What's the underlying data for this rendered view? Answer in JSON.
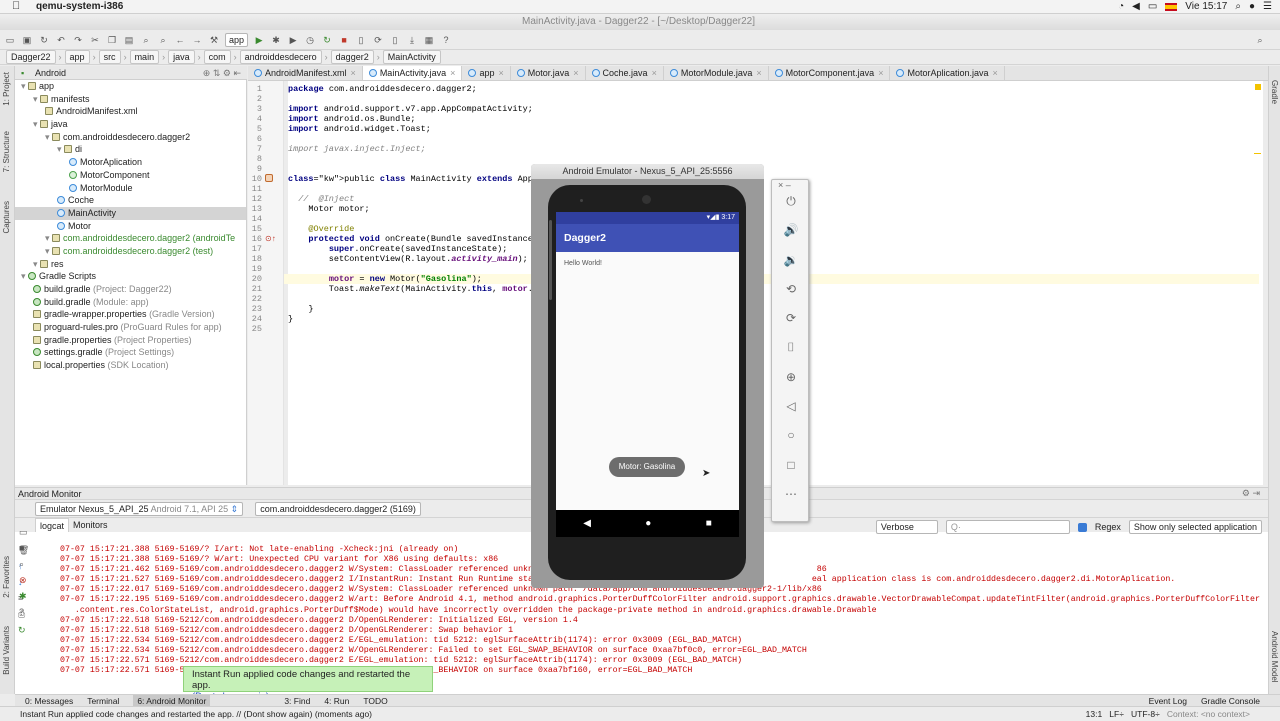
{
  "menubar": {
    "app_name": "qemu-system-i386",
    "clock": "Vie 15:17"
  },
  "window": {
    "title": "MainActivity.java - Dagger22 - [~/Desktop/Dagger22]"
  },
  "toolbar": {
    "config": "app"
  },
  "breadcrumbs": [
    "Dagger22",
    "app",
    "src",
    "main",
    "java",
    "com",
    "androiddesdecero",
    "dagger2",
    "MainActivity"
  ],
  "project_panel": {
    "view_mode": "Android",
    "rows": [
      {
        "label": "app",
        "note": "",
        "indent": 0,
        "icon": "folder"
      },
      {
        "label": "manifests",
        "note": "",
        "indent": 1,
        "icon": "folder"
      },
      {
        "label": "AndroidManifest.xml",
        "note": "",
        "indent": 2,
        "icon": "file"
      },
      {
        "label": "java",
        "note": "",
        "indent": 1,
        "icon": "folder"
      },
      {
        "label": "com.androiddesdecero.dagger2",
        "note": "",
        "indent": 2,
        "icon": "folder"
      },
      {
        "label": "di",
        "note": "",
        "indent": 3,
        "icon": "folder"
      },
      {
        "label": "MotorAplication",
        "note": "",
        "indent": 4,
        "icon": "class"
      },
      {
        "label": "MotorComponent",
        "note": "",
        "indent": 4,
        "icon": "interface"
      },
      {
        "label": "MotorModule",
        "note": "",
        "indent": 4,
        "icon": "class"
      },
      {
        "label": "Coche",
        "note": "",
        "indent": 3,
        "icon": "class"
      },
      {
        "label": "MainActivity",
        "note": "",
        "indent": 3,
        "icon": "class",
        "selected": true
      },
      {
        "label": "Motor",
        "note": "",
        "indent": 3,
        "icon": "class"
      },
      {
        "label": "com.androiddesdecero.dagger2",
        "note": "(androidTe",
        "indent": 2,
        "icon": "folder"
      },
      {
        "label": "com.androiddesdecero.dagger2",
        "note": "(test)",
        "indent": 2,
        "icon": "folder"
      },
      {
        "label": "res",
        "note": "",
        "indent": 1,
        "icon": "folder"
      },
      {
        "label": "Gradle Scripts",
        "note": "",
        "indent": 0,
        "icon": "gradle"
      },
      {
        "label": "build.gradle",
        "note": "(Project: Dagger22)",
        "indent": 1,
        "icon": "gradle"
      },
      {
        "label": "build.gradle",
        "note": "(Module: app)",
        "indent": 1,
        "icon": "gradle"
      },
      {
        "label": "gradle-wrapper.properties",
        "note": "(Gradle Version)",
        "indent": 1,
        "icon": "file"
      },
      {
        "label": "proguard-rules.pro",
        "note": "(ProGuard Rules for app)",
        "indent": 1,
        "icon": "file"
      },
      {
        "label": "gradle.properties",
        "note": "(Project Properties)",
        "indent": 1,
        "icon": "file"
      },
      {
        "label": "settings.gradle",
        "note": "(Project Settings)",
        "indent": 1,
        "icon": "gradle"
      },
      {
        "label": "local.properties",
        "note": "(SDK Location)",
        "indent": 1,
        "icon": "file"
      }
    ]
  },
  "editor_tabs": [
    {
      "label": "AndroidManifest.xml",
      "active": false
    },
    {
      "label": "MainActivity.java",
      "active": true
    },
    {
      "label": "app",
      "active": false
    },
    {
      "label": "Motor.java",
      "active": false
    },
    {
      "label": "Coche.java",
      "active": false
    },
    {
      "label": "MotorModule.java",
      "active": false
    },
    {
      "label": "MotorComponent.java",
      "active": false
    },
    {
      "label": "MotorAplication.java",
      "active": false
    }
  ],
  "code": {
    "line_numbers": [
      "1",
      "2",
      "3",
      "4",
      "5",
      "6",
      "7",
      "8",
      "9",
      "10",
      "11",
      "12",
      "13",
      "14",
      "15",
      "16",
      "17",
      "18",
      "19",
      "20",
      "21",
      "22",
      "23",
      "24",
      "25"
    ],
    "l1": "package com.androiddesdecero.dagger2;",
    "l3": "import android.support.v7.app.AppCompatActivity;",
    "l4": "import android.os.Bundle;",
    "l5": "import android.widget.Toast;",
    "l7": "import javax.inject.Inject;",
    "l10": "public class MainActivity extends AppCompatActivity",
    "l12": "  //  @Inject",
    "l13": "    Motor motor;",
    "l15": "    @Override",
    "l16": "    protected void onCreate(Bundle savedInstanceStat",
    "l17": "        super.onCreate(savedInstanceState);",
    "l18": "        setContentView(R.layout.activity_main);",
    "l20": "        motor = new Motor(\"Gasolina\");",
    "l21": "        Toast.makeText(MainActivity.this, motor.getT",
    "l23": "    }",
    "l24": "}"
  },
  "emulator": {
    "title": "Android Emulator - Nexus_5_API_25:5556",
    "status_time": "3:17",
    "app_title": "Dagger2",
    "body_text": "Hello World!",
    "toast_text": "Motor: Gasolina"
  },
  "monitor": {
    "title": "Android Monitor",
    "device": "Emulator Nexus_5_API_25",
    "device_note": "Android 7.1, API 25",
    "process": "com.androiddesdecero.dagger2",
    "process_pid": "(5169)",
    "tab_logcat": "logcat",
    "tab_monitors": "Monitors",
    "level": "Verbose",
    "search_placeholder": "Q·",
    "regex_label": "Regex",
    "filter": "Show only selected application",
    "log_lines": [
      "07-07 15:17:21.388 5169-5169/? I/art: Not late-enabling -Xcheck:jni (already on)",
      "07-07 15:17:21.388 5169-5169/? W/art: Unexpected CPU variant for X86 using defaults: x86",
      "07-07 15:17:21.462 5169-5169/com.androiddesdecero.dagger2 W/System: ClassLoader referenced unknown pa                                                   86",
      "07-07 15:17:21.527 5169-5169/com.androiddesdecero.dagger2 I/InstantRun: Instant Run Runtime started.                                                   eal application class is com.androiddesdecero.dagger2.di.MotorAplication.",
      "07-07 15:17:22.017 5169-5169/com.androiddesdecero.dagger2 W/System: ClassLoader referenced unknown path: /data/app/com.androiddesdecero.dagger2-1/lib/x86",
      "07-07 15:17:22.195 5169-5169/com.androiddesdecero.dagger2 W/art: Before Android 4.1, method android.graphics.PorterDuffColorFilter android.support.graphics.drawable.VectorDrawableCompat.updateTintFilter(android.graphics.PorterDuffColorFilter, android",
      "   .content.res.ColorStateList, android.graphics.PorterDuff$Mode) would have incorrectly overridden the package-private method in android.graphics.drawable.Drawable",
      "07-07 15:17:22.518 5169-5212/com.androiddesdecero.dagger2 D/OpenGLRenderer: Initialized EGL, version 1.4",
      "07-07 15:17:22.518 5169-5212/com.androiddesdecero.dagger2 D/OpenGLRenderer: Swap behavior 1",
      "07-07 15:17:22.534 5169-5212/com.androiddesdecero.dagger2 E/EGL_emulation: tid 5212: eglSurfaceAttrib(1174): error 0x3009 (EGL_BAD_MATCH)",
      "07-07 15:17:22.534 5169-5212/com.androiddesdecero.dagger2 W/OpenGLRenderer: Failed to set EGL_SWAP_BEHAVIOR on surface 0xaa7bf0c0, error=EGL_BAD_MATCH",
      "07-07 15:17:22.571 5169-5212/com.androiddesdecero.dagger2 E/EGL_emulation: tid 5212: eglSurfaceAttrib(1174): error 0x3009 (EGL_BAD_MATCH)",
      "07-07 15:17:22.571 5169-521                              ed to set EGL_SWAP_BEHAVIOR on surface 0xaa7bf160, error=EGL_BAD_MATCH"
    ]
  },
  "instant_run": {
    "message": "Instant Run applied code changes and restarted the app.",
    "link": "(Dont show again)"
  },
  "bottom_tabs": [
    "0: Messages",
    "Terminal",
    "6: Android Monitor",
    "3: Find",
    "4: Run",
    "TODO",
    "Event Log",
    "Gradle Console"
  ],
  "status": {
    "text": "Instant Run applied code changes and restarted the app. // (Dont show again) (moments ago)",
    "position": "13:1",
    "lf": "LF÷",
    "encoding": "UTF-8÷",
    "context": "Context: <no context>"
  },
  "side_tabs": {
    "left": [
      "1: Project",
      "7: Structure",
      "Captures",
      "2: Favorites",
      "Build Variants"
    ],
    "right": [
      "Gradle",
      "Android Model"
    ]
  }
}
